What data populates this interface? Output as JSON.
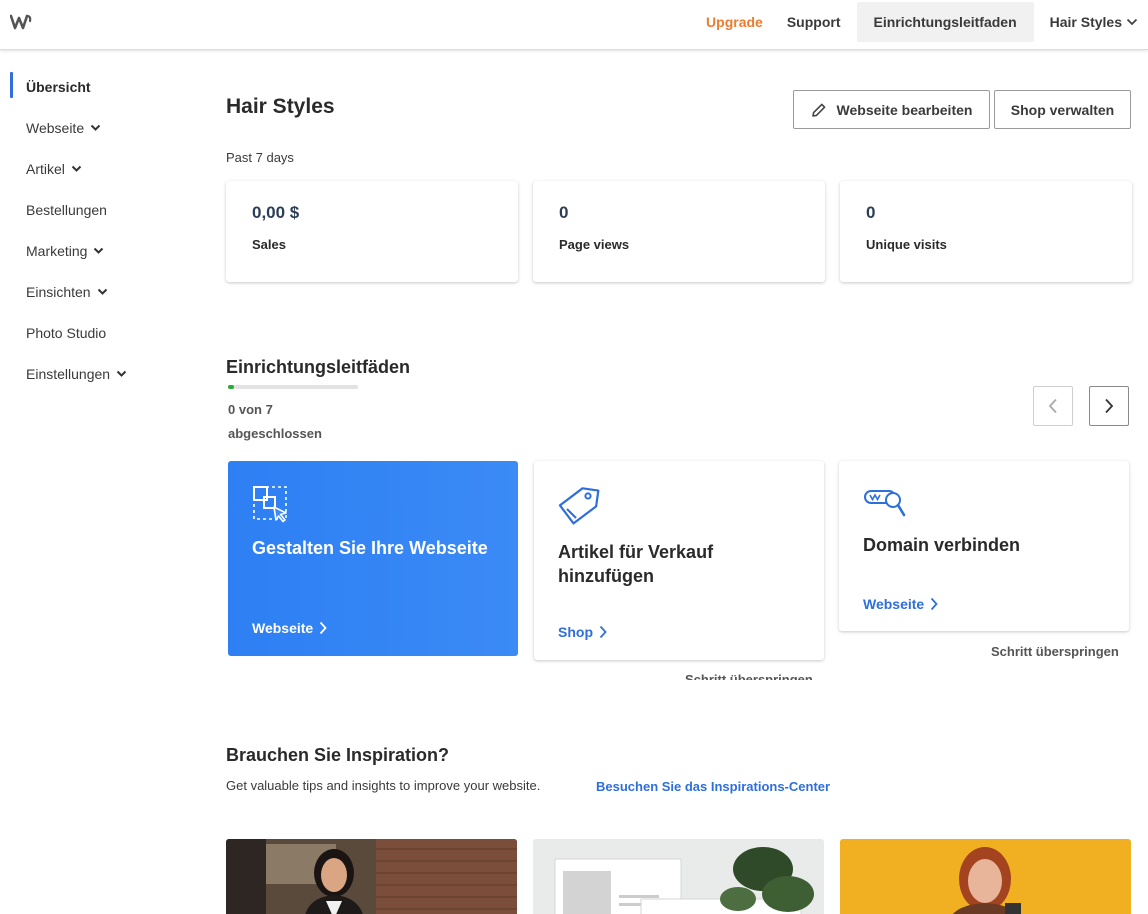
{
  "brand": {
    "logo_icon": "weebly-w-logo"
  },
  "topnav": {
    "upgrade": "Upgrade",
    "support": "Support",
    "guide": "Einrichtungsleitfaden",
    "site_name": "Hair Styles"
  },
  "sidebar": {
    "items": [
      {
        "label": "Übersicht",
        "active": true,
        "expandable": false
      },
      {
        "label": "Webseite",
        "active": false,
        "expandable": true
      },
      {
        "label": "Artikel",
        "active": false,
        "expandable": true
      },
      {
        "label": "Bestellungen",
        "active": false,
        "expandable": false
      },
      {
        "label": "Marketing",
        "active": false,
        "expandable": true
      },
      {
        "label": "Einsichten",
        "active": false,
        "expandable": true
      },
      {
        "label": "Photo Studio",
        "active": false,
        "expandable": false
      },
      {
        "label": "Einstellungen",
        "active": false,
        "expandable": true
      }
    ]
  },
  "header": {
    "title": "Hair Styles",
    "edit_button": "Webseite bearbeiten",
    "shop_button": "Shop verwalten",
    "period": "Past 7 days"
  },
  "stats": [
    {
      "value": "0,00 $",
      "label": "Sales"
    },
    {
      "value": "0",
      "label": "Page views"
    },
    {
      "value": "0",
      "label": "Unique visits"
    }
  ],
  "guides": {
    "title": "Einrichtungsleitfäden",
    "progress_line1": "0 von 7",
    "progress_line2": "abgeschlossen",
    "progress_completed": 0,
    "progress_total": 7,
    "cards": [
      {
        "icon": "design-select-cursor-icon",
        "title": "Gestalten Sie Ihre Webseite",
        "link": "Webseite"
      },
      {
        "icon": "price-tag-icon",
        "title": "Artikel für Verkauf hinzufügen",
        "link": "Shop",
        "skip": "Schritt überspringen"
      },
      {
        "icon": "domain-search-icon",
        "title": "Domain verbinden",
        "link": "Webseite",
        "skip": "Schritt überspringen"
      }
    ]
  },
  "inspiration": {
    "title": "Brauchen Sie Inspiration?",
    "subtitle": "Get valuable tips and insights to improve your website.",
    "link": "Besuchen Sie das Inspirations-Center"
  },
  "colors": {
    "accent_blue": "#2e6fdb",
    "upgrade_orange": "#ef7b2f",
    "progress_green": "#2cab3c",
    "card_blue": "#3b8af6"
  }
}
